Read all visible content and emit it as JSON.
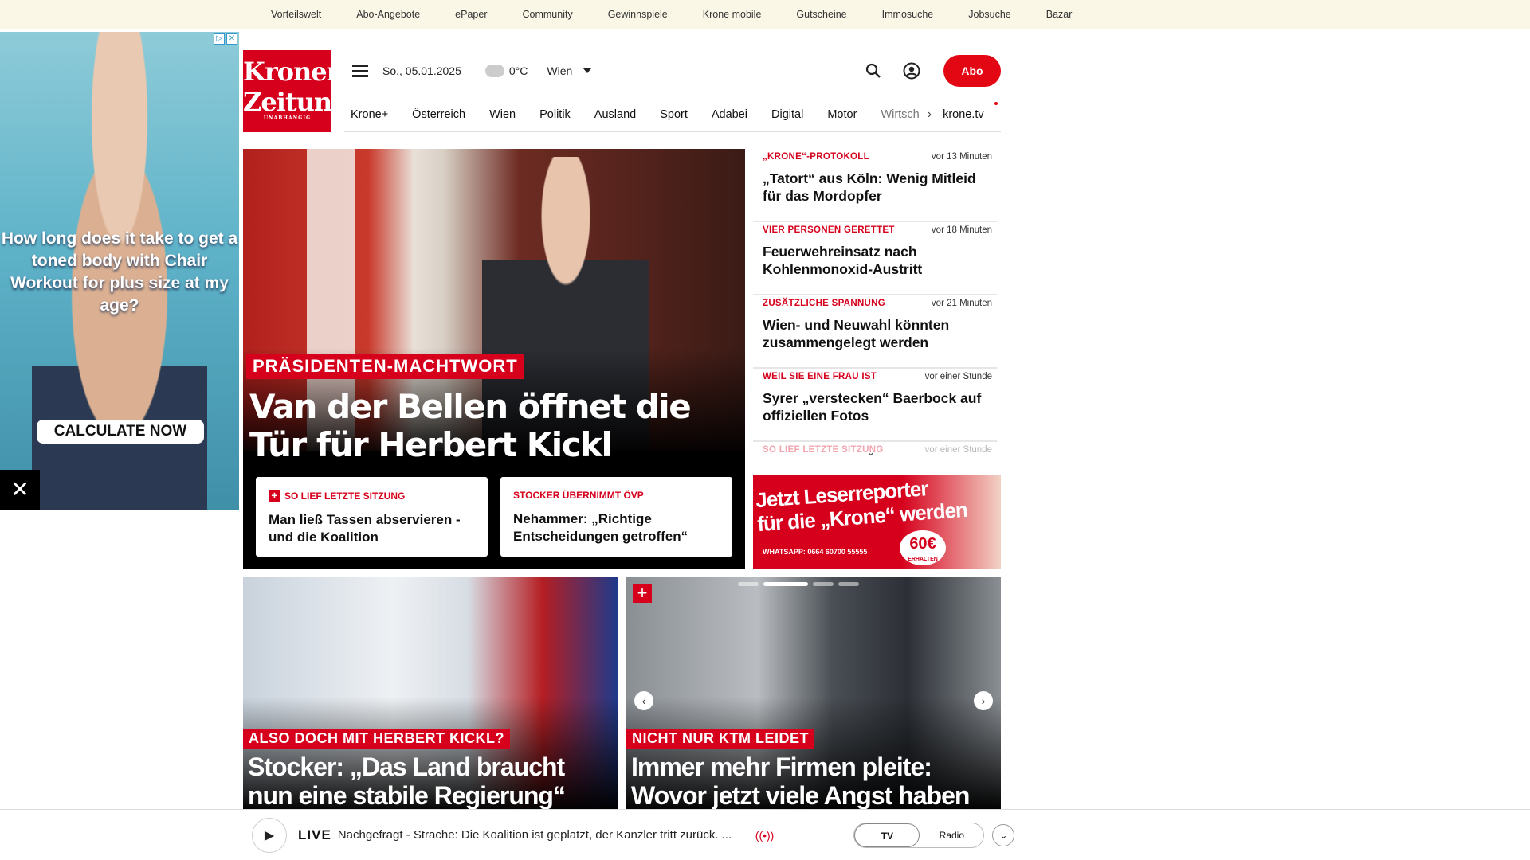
{
  "topnav": [
    "Vorteilswelt",
    "Abo-Angebote",
    "ePaper",
    "Community",
    "Gewinnspiele",
    "Krone mobile",
    "Gutscheine",
    "Immosuche",
    "Jobsuche",
    "Bazar"
  ],
  "ad": {
    "headline": "How long does it take to get a toned body with Chair Workout for plus size at my age?",
    "cta": "CALCULATE NOW"
  },
  "logo": {
    "line1": "Kronen",
    "line2": "Zeitung",
    "line3": "UNABHÄNGIG"
  },
  "header": {
    "date": "So., 05.01.2025",
    "temp": "0°C",
    "city": "Wien",
    "abo": "Abo"
  },
  "nav": [
    "Krone+",
    "Österreich",
    "Wien",
    "Politik",
    "Ausland",
    "Sport",
    "Adabei",
    "Digital",
    "Motor",
    "Wirtsch"
  ],
  "nav_tv": "krone.tv",
  "hero": {
    "kicker": "PRÄSIDENTEN-MACHTWORT",
    "title": "Van der Bellen öffnet die Tür für Herbert Kickl",
    "sub1": {
      "kicker": "SO LIEF LETZTE SITZUNG",
      "title": "Man ließ Tassen abservieren - und die Koalition"
    },
    "sub2": {
      "kicker": "STOCKER ÜBERNIMMT ÖVP",
      "title": "Nehammer: „Richtige Entscheidungen getroffen“"
    }
  },
  "side": [
    {
      "kicker": "„KRONE“-PROTOKOLL",
      "time": "vor 13 Minuten",
      "title": "„Tatort“ aus Köln: Wenig Mitleid für das Mordopfer"
    },
    {
      "kicker": "VIER PERSONEN GERETTET",
      "time": "vor 18 Minuten",
      "title": "Feuerwehreinsatz nach Kohlenmonoxid-Austritt"
    },
    {
      "kicker": "ZUSÄTZLICHE SPANNUNG",
      "time": "vor 21 Minuten",
      "title": "Wien- und Neuwahl könnten zusammengelegt werden"
    },
    {
      "kicker": "WEIL SIE EINE FRAU IST",
      "time": "vor einer Stunde",
      "title": "Syrer „verstecken“ Baerbock auf offiziellen Fotos"
    },
    {
      "kicker": "SO LIEF LETZTE SITZUNG",
      "time": "vor einer Stunde",
      "title": ""
    }
  ],
  "banner": {
    "line1": "Jetzt Leserreporter",
    "line2": "für die „Krone“ werden",
    "whatsapp": "WHATSAPP: 0664 60700 55555",
    "amount": "60€",
    "amount_sub": "ERHALTEN"
  },
  "card1": {
    "kicker": "ALSO DOCH MIT HERBERT KICKL?",
    "title": "Stocker: „Das Land braucht nun eine stabile Regierung“"
  },
  "card2": {
    "kicker": "NICHT NUR KTM LEIDET",
    "title": "Immer mehr Firmen pleite: Wovor jetzt viele Angst haben"
  },
  "player": {
    "live": "LIVE",
    "text": "Nachgefragt - Strache: Die Koalition ist geplatzt, der Kanzler tritt zurück. ...",
    "tv": "TV",
    "radio": "Radio"
  },
  "colors": {
    "brand": "#d6001c",
    "topbar": "#fbf7e7"
  }
}
